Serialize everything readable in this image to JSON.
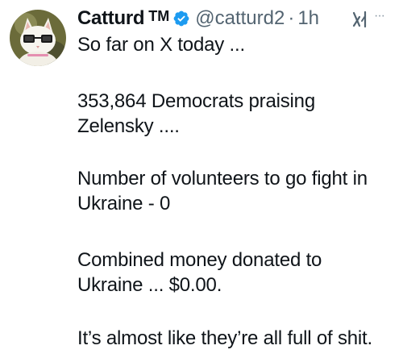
{
  "author": {
    "display_name": "Catturd",
    "tm_mark": "TM",
    "handle": "@catturd2",
    "separator": "·",
    "time": "1h",
    "verified": true,
    "avatar_icon": "cat-with-glasses-avatar",
    "verified_color": "#1d9bf0"
  },
  "actions": {
    "grok_icon": "grok-icon",
    "more_label": "···"
  },
  "tweet": {
    "lines": [
      "So far on X today ...",
      "353,864 Democrats praising",
      "Zelensky ....",
      "Number of volunteers to go fight in",
      "Ukraine - 0",
      "Combined money donated to",
      "Ukraine ... $0.00.",
      "It’s almost like they’re all full of shit."
    ]
  }
}
